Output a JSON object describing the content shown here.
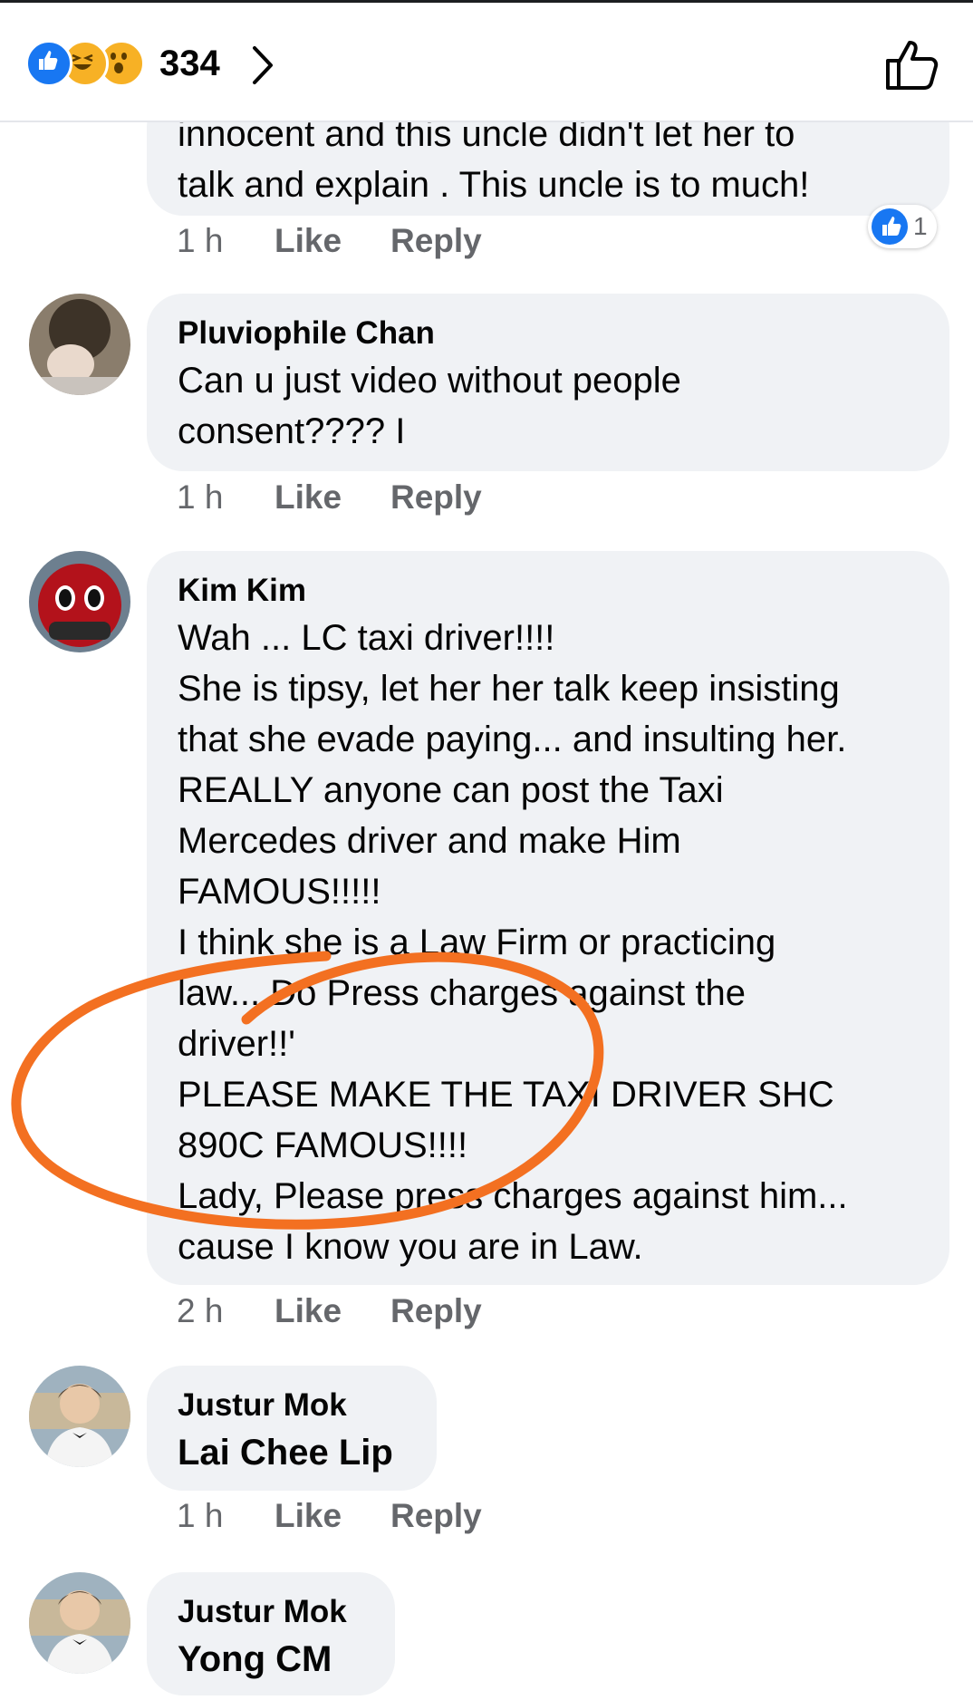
{
  "header": {
    "reaction_count": "334",
    "reactions": [
      "like-icon",
      "haha-icon",
      "wow-icon"
    ]
  },
  "colors": {
    "accent": "#1877f2",
    "bubble": "#f0f2f5",
    "meta_text": "#65676b",
    "annotation": "#f37021"
  },
  "comments": [
    {
      "author": "",
      "text": "innocent and this uncle didn't let her to\ntalk and explain . This uncle is to much!",
      "time": "1 h",
      "like": "Like",
      "reply": "Reply",
      "reaction_count": "1"
    },
    {
      "author": "Pluviophile Chan",
      "text": "Can u just video without people\nconsent????  I",
      "time": "1 h",
      "like": "Like",
      "reply": "Reply"
    },
    {
      "author": "Kim Kim",
      "text": "Wah ... LC taxi driver!!!!\nShe is tipsy, let her her talk keep insisting\nthat she evade paying... and insulting her.\nREALLY anyone can post the Taxi\nMercedes driver and make Him\nFAMOUS!!!!!\nI think she is a Law Firm or practicing\nlaw... Do Press charges against the\ndriver!!'\nPLEASE MAKE THE TAXI DRIVER SHC\n890C FAMOUS!!!!\nLady, Please press charges against him...\ncause I know you are in Law.",
      "time": "2 h",
      "like": "Like",
      "reply": "Reply"
    },
    {
      "author": "Justur Mok",
      "text": "Lai Chee Lip",
      "time": "1 h",
      "like": "Like",
      "reply": "Reply"
    },
    {
      "author": "Justur Mok",
      "text": "Yong CM"
    }
  ]
}
